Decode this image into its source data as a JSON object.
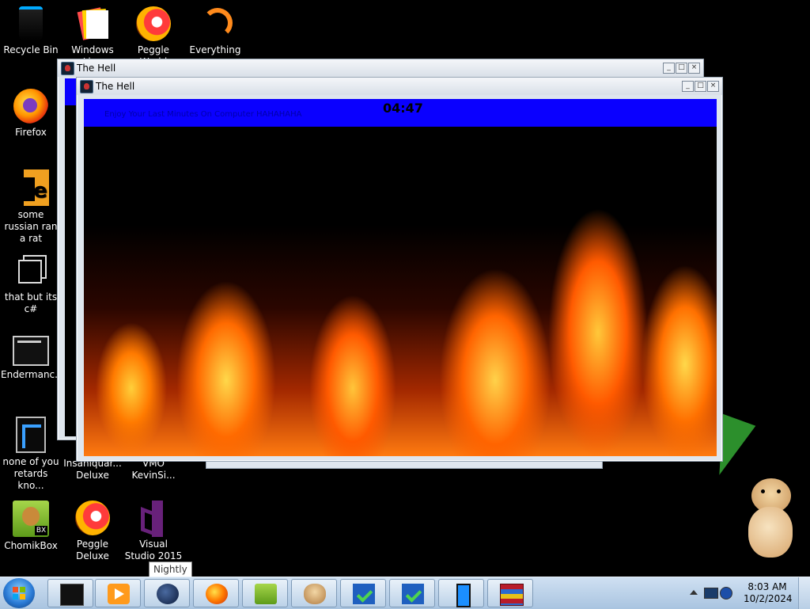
{
  "desktop": {
    "icons": [
      {
        "label": "Recycle Bin",
        "icon": "recycle-bin-icon"
      },
      {
        "label": "Windows Live",
        "icon": "windows-live-icon"
      },
      {
        "label": "Peggle World",
        "icon": "peggle-world-icon"
      },
      {
        "label": "Everything",
        "icon": "everything-icon"
      },
      {
        "label": "Firefox",
        "icon": "firefox-icon"
      },
      {
        "label": "some russian ran a rat",
        "icon": "shortcut-icon"
      },
      {
        "label": "that but its c#",
        "icon": "shortcut-icon"
      },
      {
        "label": "Endermanc...",
        "icon": "program-icon"
      },
      {
        "label": "none of you retards kno...",
        "icon": "program-icon"
      },
      {
        "label": "Insaniquar... Deluxe",
        "icon": "program-icon"
      },
      {
        "label": "VMO KevinSi...",
        "icon": "program-icon"
      },
      {
        "label": "ChomikBox",
        "icon": "chomikbox-icon"
      },
      {
        "label": "Peggle Deluxe",
        "icon": "peggle-deluxe-icon"
      },
      {
        "label": "Visual Studio 2015",
        "icon": "visual-studio-icon"
      }
    ]
  },
  "windows": {
    "back": {
      "title": "The Hell"
    },
    "front": {
      "title": "The Hell",
      "timer": "04:47",
      "banner_text": "Enjoy Your Last Minutes On Computer HAHAHAHA"
    }
  },
  "tooltip": "Nightly",
  "taskbar": {
    "clock_time": "8:03 AM",
    "clock_date": "10/2/2024",
    "buttons": [
      "terminal-icon",
      "media-player-icon",
      "nightly-icon",
      "firefox-icon",
      "chomikbox-icon",
      "hamster-icon",
      "checklist-icon",
      "checklist-icon",
      "phone-icon",
      "winrar-icon"
    ]
  },
  "colors": {
    "banner": "#0a00ff",
    "taskbar": "#bcd2e8"
  }
}
